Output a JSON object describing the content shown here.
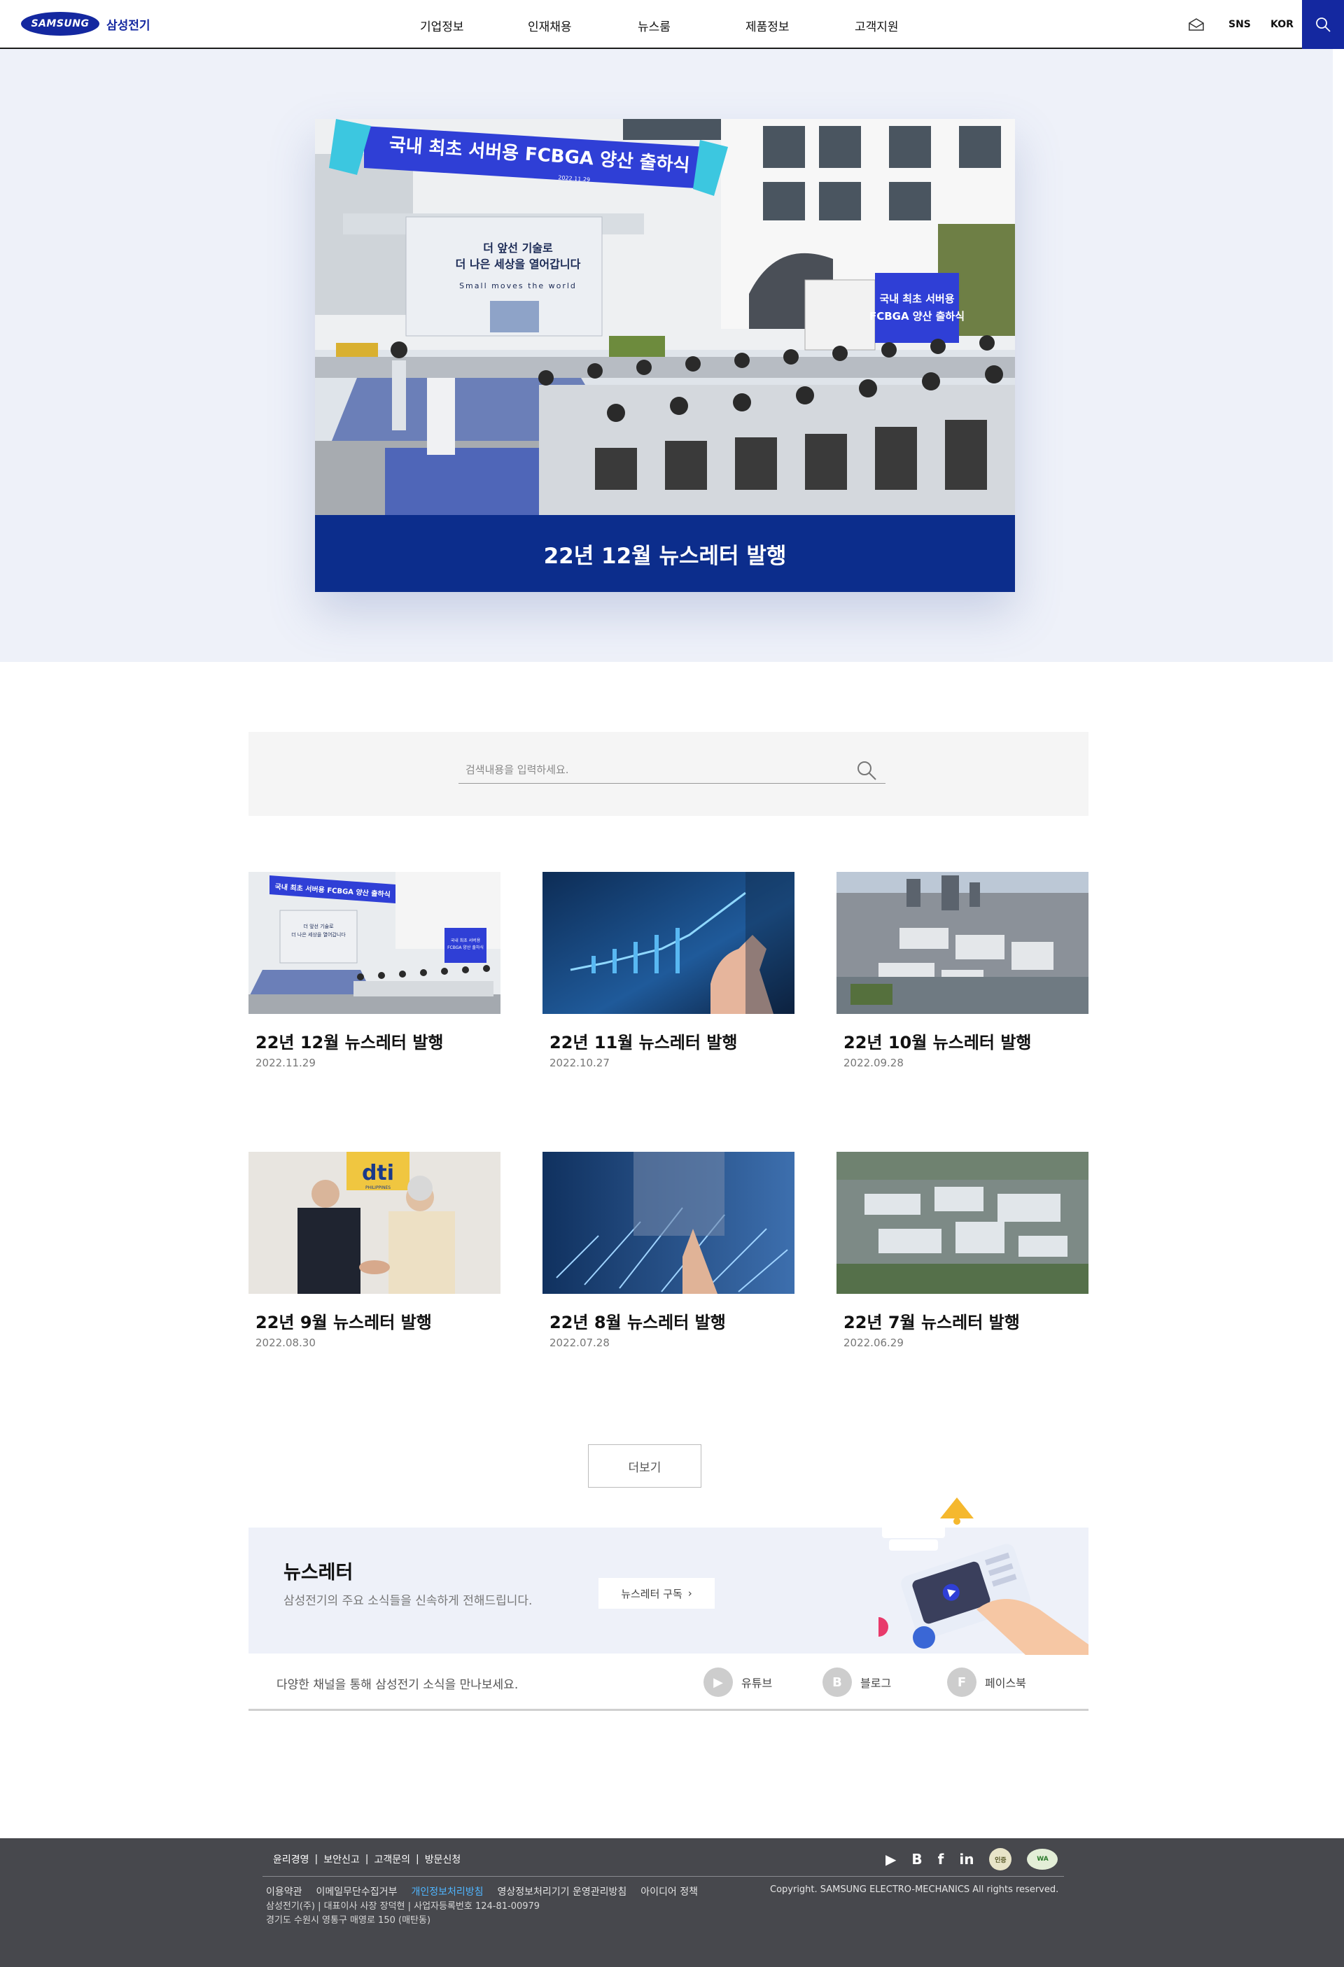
{
  "header": {
    "logo_text": "SAMSUNG",
    "logo_ko": "삼성전기",
    "nav": [
      "기업정보",
      "인재채용",
      "뉴스룸",
      "제품정보",
      "고객지원"
    ],
    "sns_label": "SNS",
    "lang_label": "KOR",
    "accent_color": "#1428a0",
    "icons": [
      "mail-icon",
      "search-icon"
    ]
  },
  "hero": {
    "caption": "22년 12월 뉴스레터 발행",
    "banner_text": "국내 최초 서버용 FCBGA 양산 출하식",
    "banner_date": "2022.11.29",
    "screen_line1": "더 앞선 기술로",
    "screen_line2": "더 나은 세상을 열어갑니다",
    "screen_line3": "Small moves the world",
    "truck_line1": "국내 최초 서버용",
    "truck_line2": "FCBGA 양산 출하식",
    "caption_bg": "#0c2d8c"
  },
  "search": {
    "placeholder": "검색내용을 입력하세요."
  },
  "cards": [
    {
      "title": "22년 12월 뉴스레터 발행",
      "date": "2022.11.29",
      "image": "ceremony"
    },
    {
      "title": "22년 11월 뉴스레터 발행",
      "date": "2022.10.27",
      "image": "growth-chart-hand"
    },
    {
      "title": "22년 10월 뉴스레터 발행",
      "date": "2022.09.28",
      "image": "aerial-campus"
    },
    {
      "title": "22년 9월 뉴스레터 발행",
      "date": "2022.08.30",
      "image": "handshake"
    },
    {
      "title": "22년 8월 뉴스레터 발행",
      "date": "2022.07.28",
      "image": "arrows-hand"
    },
    {
      "title": "22년 7월 뉴스레터 발행",
      "date": "2022.06.29",
      "image": "aerial-factory"
    }
  ],
  "card_img1": {
    "banner": "국내 최초 서버용 FCBGA 양산 출하식",
    "screen_line1": "더 앞선 기술로",
    "screen_line2": "더 나은 세상을 열어갑니다",
    "truck_line1": "국내 최초 서버용",
    "truck_line2": "FCBGA 양산 출하식"
  },
  "card_img4": {
    "sign_logo": "dti",
    "sign_sub": "PHILIPPINES"
  },
  "more_label": "더보기",
  "newsletter": {
    "title": "뉴스레터",
    "desc": "삼성전기의 주요 소식들을 신속하게 전해드립니다.",
    "subscribe_label": "뉴스레터 구독",
    "bg_color": "#eef1f9"
  },
  "channels": {
    "text": "다양한 채널을 통해 삼성전기 소식을 만나보세요.",
    "items": [
      {
        "glyph": "▶",
        "label": "유튜브"
      },
      {
        "glyph": "B",
        "label": "블로그"
      },
      {
        "glyph": "F",
        "label": "페이스북"
      }
    ]
  },
  "footer": {
    "top_links": [
      "윤리경영",
      "보안신고",
      "고객문의",
      "방문신청"
    ],
    "social_glyphs": [
      "▶",
      "B",
      "f",
      "in"
    ],
    "badge1": "인증",
    "badge2": "WA",
    "links": [
      "이용약관",
      "이메일무단수집거부",
      "개인정보처리방침",
      "영상정보처리기기 운영관리방침",
      "아이디어 정책"
    ],
    "highlight_link_color": "#4fb5ff",
    "copyright": "Copyright. SAMSUNG ELECTRO-MECHANICS All rights reserved.",
    "info1": "삼성전기(주) | 대표이사 사장 장덕현 | 사업자등록번호 124-81-00979",
    "info2": "경기도 수원시 영통구 매영로 150 (매탄동)",
    "bg_color": "#47484d"
  }
}
